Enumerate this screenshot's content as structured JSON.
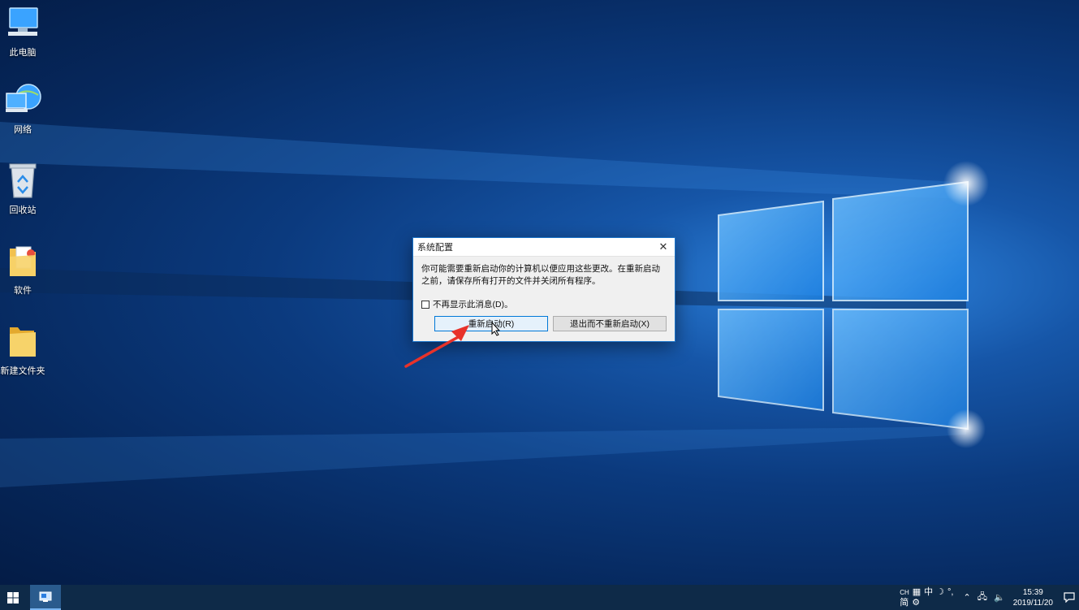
{
  "desktop": {
    "icons": [
      {
        "label": "此电脑",
        "icon": "computer-icon"
      },
      {
        "label": "网络",
        "icon": "network-icon"
      },
      {
        "label": "回收站",
        "icon": "recycle-bin-icon"
      },
      {
        "label": "软件",
        "icon": "folder-icon"
      },
      {
        "label": "新建文件夹",
        "icon": "folder-icon"
      }
    ]
  },
  "dialog": {
    "title": "系统配置",
    "message": "你可能需要重新启动你的计算机以便应用这些更改。在重新启动之前，请保存所有打开的文件并关闭所有程序。",
    "checkbox_label": "不再显示此消息(D)。",
    "checkbox_checked": false,
    "restart_label": "重新启动(R)",
    "exit_label": "退出而不重新启动(X)"
  },
  "taskbar": {
    "ime": {
      "lang": "CH",
      "mode": "中",
      "script": "简"
    },
    "time": "15:39",
    "date": "2019/11/20"
  },
  "colors": {
    "accent": "#0078d7",
    "annotation_arrow": "#e8322a",
    "taskbar": "#0e2a48"
  }
}
